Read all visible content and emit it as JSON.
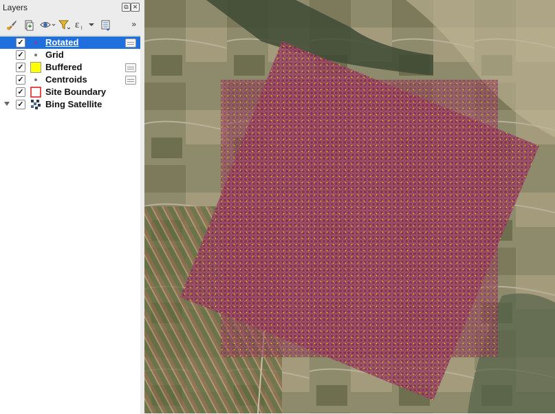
{
  "panel": {
    "title": "Layers",
    "float_icon": "restore-icon",
    "close_icon": "close-icon",
    "more_label": "»"
  },
  "toolbar": [
    {
      "name": "style-manager-button",
      "icon": "paintbrush-icon"
    },
    {
      "name": "add-group-button",
      "icon": "add-group-icon"
    },
    {
      "name": "manage-visibility-button",
      "icon": "eye-icon"
    },
    {
      "name": "filter-legend-button",
      "icon": "filter-icon"
    },
    {
      "name": "filter-expression-button",
      "icon": "expression-icon"
    },
    {
      "name": "collapse-all-button",
      "icon": "collapse-icon"
    }
  ],
  "layers": [
    {
      "name": "Rotated",
      "checked": true,
      "selected": true,
      "symbol": "point",
      "editable": true
    },
    {
      "name": "Grid",
      "checked": true,
      "selected": false,
      "symbol": "point",
      "editable": false
    },
    {
      "name": "Buffered",
      "checked": true,
      "selected": false,
      "symbol": "fill-yellow",
      "editable": true
    },
    {
      "name": "Centroids",
      "checked": true,
      "selected": false,
      "symbol": "point",
      "editable": true
    },
    {
      "name": "Site Boundary",
      "checked": true,
      "selected": false,
      "symbol": "outline-red",
      "editable": false
    },
    {
      "name": "Bing Satellite",
      "checked": true,
      "selected": false,
      "symbol": "raster",
      "editable": false,
      "expandable": true
    }
  ],
  "colors": {
    "selection": "#1f6fde",
    "grid_cells": "#8a2f4e",
    "buffered": "#ffff00",
    "site_boundary": "#e02020",
    "satellite_base": "#8e8a6c"
  }
}
